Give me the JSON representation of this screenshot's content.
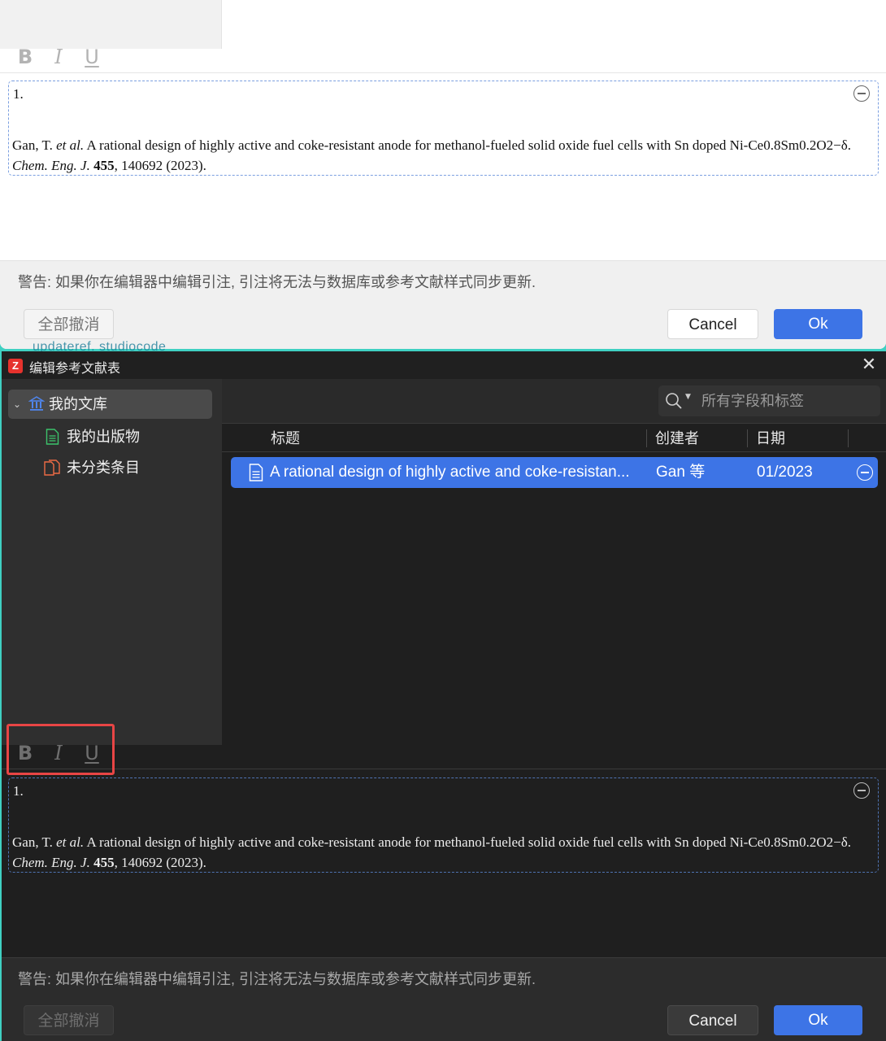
{
  "toolbar": {
    "bold": "B",
    "italic": "I",
    "underline": "U"
  },
  "citation": {
    "number": "1.",
    "authors": "Gan, T. ",
    "et_al": "et al.",
    "title": " A rational design of highly active and coke-resistant anode for methanol-fueled solid oxide fuel cells with Sn doped Ni-Ce0.8Sm0.2O2−δ. ",
    "journal": "Chem. Eng. J.",
    "volume": "455",
    "pages_year": ", 140692 (2023)."
  },
  "footer": {
    "warning": "警告: 如果你在编辑器中编辑引注, 引注将无法与数据库或参考文献样式同步更新.",
    "revert_all": "全部撤消",
    "cancel": "Cancel",
    "ok": "Ok"
  },
  "background_text": "updateref.  studiocode",
  "window": {
    "title": "编辑参考文献表",
    "app_icon": "Z",
    "close": "✕"
  },
  "sidebar": {
    "my_library": "我的文库",
    "my_publications": "我的出版物",
    "unfiled_items": "未分类条目"
  },
  "search": {
    "placeholder": "所有字段和标签"
  },
  "columns": {
    "title": "标题",
    "creator": "创建者",
    "date": "日期"
  },
  "items": [
    {
      "title": "A rational design of highly active and coke-resistan...",
      "creator": "Gan 等",
      "date": "01/2023"
    }
  ],
  "colors": {
    "accent": "#3d74e6",
    "highlight": "#e84545",
    "app_icon": "#e6322d"
  },
  "icons": {
    "library": "library-icon",
    "publications": "document-icon",
    "unfiled": "unfiled-items-icon",
    "search": "search-icon",
    "item": "document-icon",
    "remove": "minus-circle-icon",
    "close": "close-icon"
  }
}
